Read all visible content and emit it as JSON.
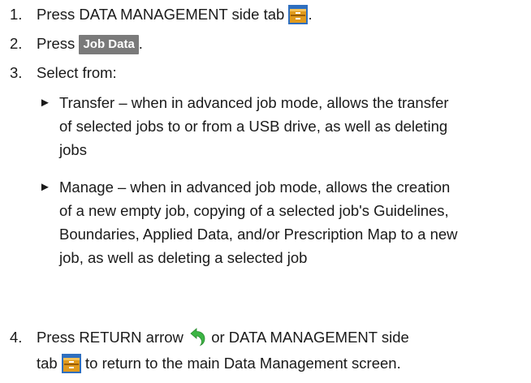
{
  "steps": [
    {
      "num": "1.",
      "pre": "Press DATA MANAGEMENT side tab ",
      "icon": "data-management-tab-icon",
      "post": "."
    },
    {
      "num": "2.",
      "pre": "Press ",
      "button": "Job Data",
      "post": "."
    },
    {
      "num": "3.",
      "text": "Select from:"
    },
    {
      "num": "4.",
      "line1_pre": "Press RETURN arrow ",
      "icon_return": "return-arrow-icon",
      "line1_post": " or DATA MANAGEMENT side",
      "line2_pre": "tab ",
      "icon_tab": "data-management-tab-icon",
      "line2_post": " to return to the main Data Management screen."
    }
  ],
  "sub_items": [
    {
      "marker": "►",
      "lines": [
        "Transfer – when in advanced job mode, allows the transfer",
        "of selected jobs to or from a USB drive, as well as deleting",
        "jobs"
      ]
    },
    {
      "marker": "►",
      "lines": [
        "Manage – when in advanced job mode, allows the creation",
        "of a new empty job, copying of a selected job's Guidelines,",
        "Boundaries, Applied Data, and/or Prescription Map to a new",
        "job, as well as deleting a selected job"
      ]
    }
  ]
}
